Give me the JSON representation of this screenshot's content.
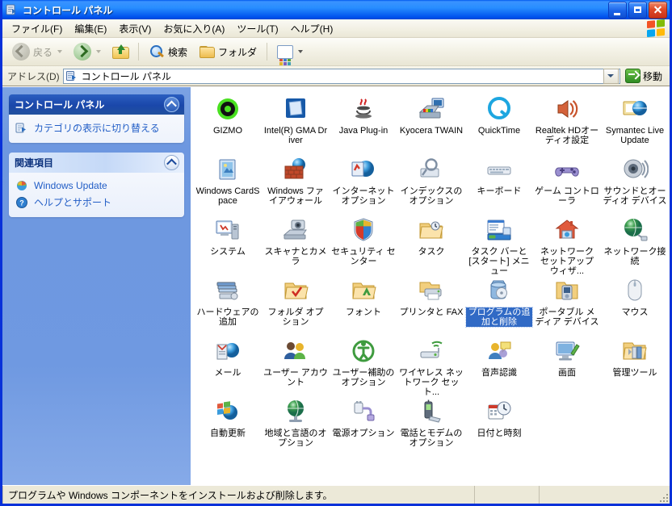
{
  "window": {
    "title": "コントロール パネル",
    "title_icon": "control-panel-icon",
    "buttons": {
      "minimize": "最小化",
      "maximize": "最大化",
      "close": "閉じる"
    }
  },
  "menu": {
    "items": [
      {
        "label": "ファイル(F)"
      },
      {
        "label": "編集(E)"
      },
      {
        "label": "表示(V)"
      },
      {
        "label": "お気に入り(A)"
      },
      {
        "label": "ツール(T)"
      },
      {
        "label": "ヘルプ(H)"
      }
    ]
  },
  "toolbar": {
    "back_label": "戻る",
    "forward_label": "",
    "up_label": "",
    "search_label": "検索",
    "folders_label": "フォルダ",
    "views_label": ""
  },
  "address": {
    "label": "アドレス(D)",
    "value": "コントロール パネル",
    "go_label": "移動"
  },
  "sidebar": {
    "panels": [
      {
        "title": "コントロール パネル",
        "style": "dark",
        "links": [
          {
            "label": "カテゴリの表示に切り替える",
            "icon": "switch-view-icon"
          }
        ]
      },
      {
        "title": "関連項目",
        "style": "light",
        "links": [
          {
            "label": "Windows Update",
            "icon": "windows-update-icon"
          },
          {
            "label": "ヘルプとサポート",
            "icon": "help-support-icon"
          }
        ]
      }
    ]
  },
  "items": [
    {
      "label": "GIZMO",
      "icon": "gizmo-icon",
      "selected": false
    },
    {
      "label": "Intel(R) GMA Driver",
      "icon": "intel-gma-icon",
      "selected": false
    },
    {
      "label": "Java Plug-in",
      "icon": "java-icon",
      "selected": false
    },
    {
      "label": "Kyocera TWAIN",
      "icon": "scanner-icon",
      "selected": false
    },
    {
      "label": "QuickTime",
      "icon": "quicktime-icon",
      "selected": false
    },
    {
      "label": "Realtek HDオーディオ設定",
      "icon": "speaker-icon",
      "selected": false
    },
    {
      "label": "Symantec LiveUpdate",
      "icon": "liveupdate-icon",
      "selected": false
    },
    {
      "label": "Windows CardSpace",
      "icon": "cardspace-icon",
      "selected": false
    },
    {
      "label": "Windows ファイアウォール",
      "icon": "firewall-icon",
      "selected": false
    },
    {
      "label": "インターネット オプション",
      "icon": "internet-options-icon",
      "selected": false
    },
    {
      "label": "インデックスのオプション",
      "icon": "indexing-options-icon",
      "selected": false
    },
    {
      "label": "キーボード",
      "icon": "keyboard-icon",
      "selected": false
    },
    {
      "label": "ゲーム コントローラ",
      "icon": "gamepad-icon",
      "selected": false
    },
    {
      "label": "サウンドとオーディオ デバイス",
      "icon": "sound-devices-icon",
      "selected": false
    },
    {
      "label": "システム",
      "icon": "system-icon",
      "selected": false
    },
    {
      "label": "スキャナとカメラ",
      "icon": "scanner-camera-icon",
      "selected": false
    },
    {
      "label": "セキュリティ センター",
      "icon": "security-shield-icon",
      "selected": false
    },
    {
      "label": "タスク",
      "icon": "scheduled-tasks-icon",
      "selected": false
    },
    {
      "label": "タスク バーと [スタート] メニュー",
      "icon": "taskbar-startmenu-icon",
      "selected": false
    },
    {
      "label": "ネットワーク セットアップ ウィザ...",
      "icon": "network-setup-wizard-icon",
      "selected": false
    },
    {
      "label": "ネットワーク接続",
      "icon": "network-connections-icon",
      "selected": false
    },
    {
      "label": "ハードウェアの追加",
      "icon": "add-hardware-icon",
      "selected": false
    },
    {
      "label": "フォルダ オプション",
      "icon": "folder-options-icon",
      "selected": false
    },
    {
      "label": "フォント",
      "icon": "fonts-icon",
      "selected": false
    },
    {
      "label": "プリンタと FAX",
      "icon": "printers-fax-icon",
      "selected": false
    },
    {
      "label": "プログラムの追加と削除",
      "icon": "add-remove-programs-icon",
      "selected": true
    },
    {
      "label": "ポータブル メディア デバイス",
      "icon": "portable-media-icon",
      "selected": false
    },
    {
      "label": "マウス",
      "icon": "mouse-icon",
      "selected": false
    },
    {
      "label": "メール",
      "icon": "mail-icon",
      "selected": false
    },
    {
      "label": "ユーザー アカウント",
      "icon": "user-accounts-icon",
      "selected": false
    },
    {
      "label": "ユーザー補助のオプション",
      "icon": "accessibility-icon",
      "selected": false
    },
    {
      "label": "ワイヤレス ネットワーク セット...",
      "icon": "wireless-network-icon",
      "selected": false
    },
    {
      "label": "音声認識",
      "icon": "speech-icon",
      "selected": false
    },
    {
      "label": "画面",
      "icon": "display-icon",
      "selected": false
    },
    {
      "label": "管理ツール",
      "icon": "admin-tools-icon",
      "selected": false
    },
    {
      "label": "自動更新",
      "icon": "automatic-updates-icon",
      "selected": false
    },
    {
      "label": "地域と言語のオプション",
      "icon": "regional-options-icon",
      "selected": false
    },
    {
      "label": "電源オプション",
      "icon": "power-options-icon",
      "selected": false
    },
    {
      "label": "電話とモデムのオプション",
      "icon": "phone-modem-icon",
      "selected": false
    },
    {
      "label": "日付と時刻",
      "icon": "date-time-icon",
      "selected": false
    }
  ],
  "statusbar": {
    "message": "プログラムや Windows コンポーネントをインストールおよび削除します。",
    "segment2": "",
    "segment3": ""
  },
  "colors": {
    "titlebar_blue": "#0058ee",
    "window_border": "#0831d9",
    "selection_blue": "#316ac5",
    "sidebar_blue": "#6d97e0",
    "link_blue": "#215dc6",
    "chrome_beige": "#ece9d8"
  }
}
